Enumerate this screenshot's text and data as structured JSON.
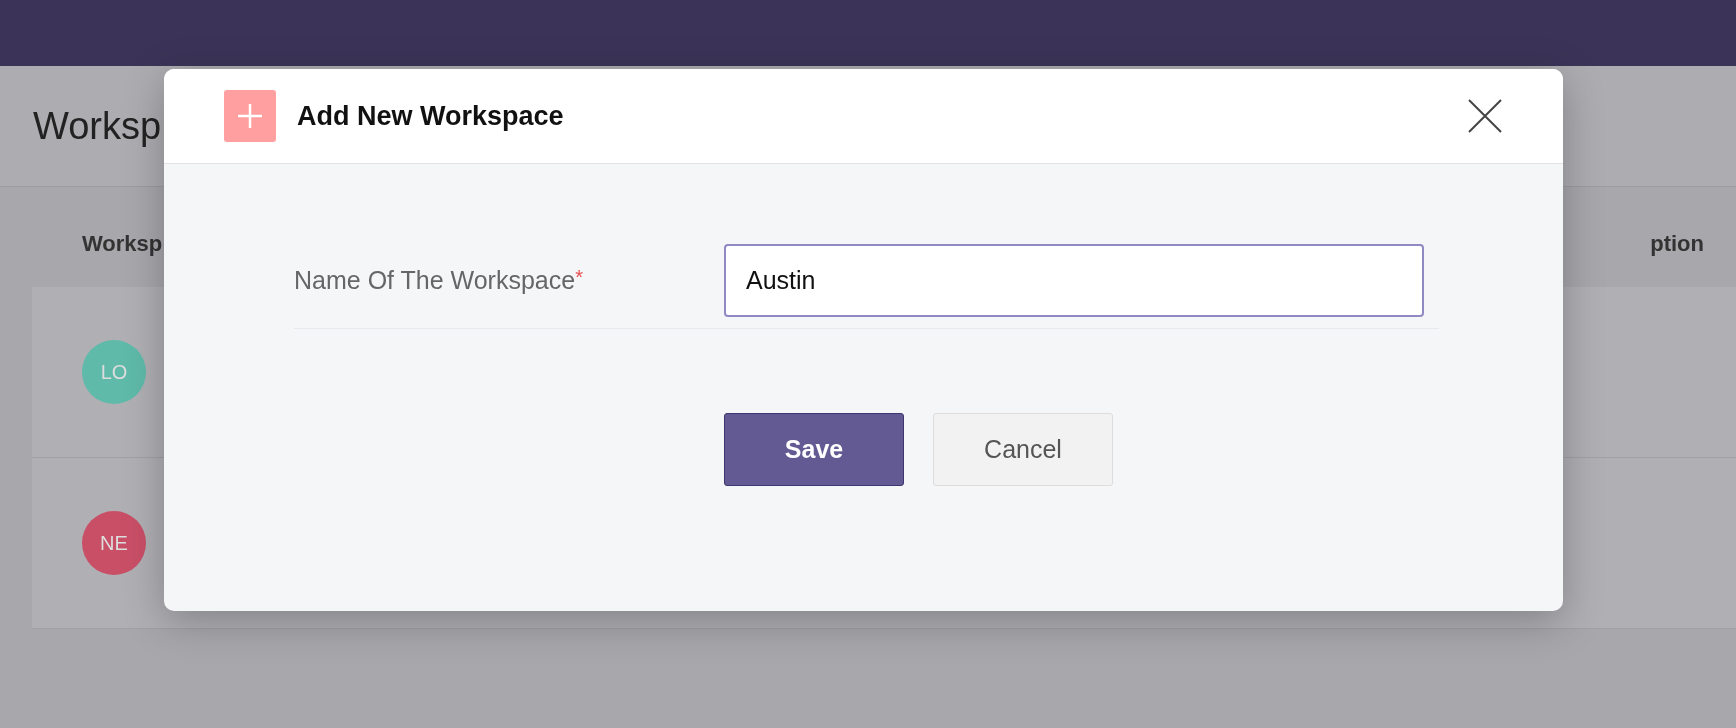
{
  "page": {
    "title": "Worksp",
    "table": {
      "columns": [
        "Worksp",
        "ption"
      ],
      "rows": [
        {
          "initials": "LO",
          "color": "#5fbaa9"
        },
        {
          "initials": "NE",
          "color": "#c94f67"
        }
      ]
    }
  },
  "modal": {
    "title": "Add New Workspace",
    "field": {
      "label": "Name Of The Workspace",
      "required_mark": "*",
      "value": "Austin"
    },
    "buttons": [
      {
        "label": "Save",
        "kind": "primary"
      },
      {
        "label": "Cancel",
        "kind": "secondary"
      }
    ]
  }
}
